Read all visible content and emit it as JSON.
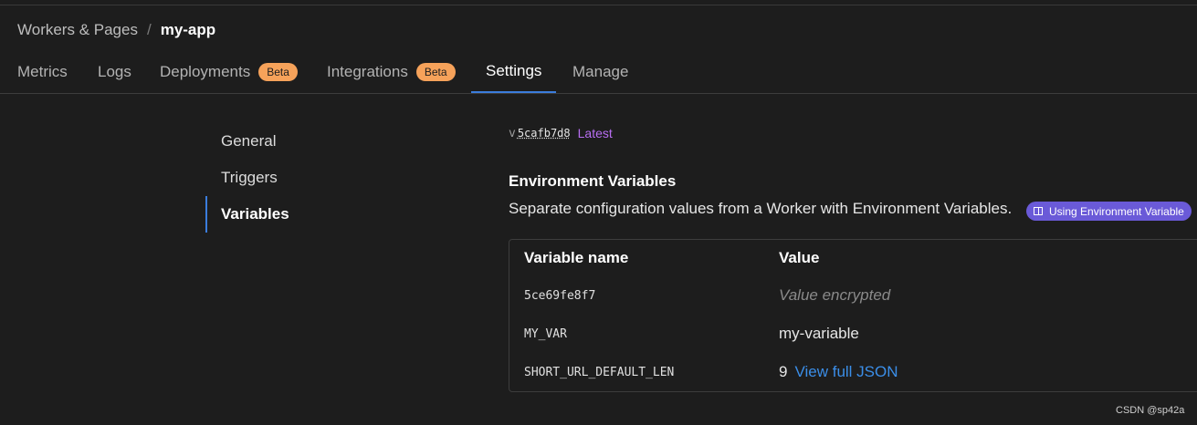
{
  "breadcrumb": {
    "parent": "Workers & Pages",
    "separator": "/",
    "current": "my-app"
  },
  "tabs": [
    {
      "label": "Metrics"
    },
    {
      "label": "Logs"
    },
    {
      "label": "Deployments",
      "badge": "Beta"
    },
    {
      "label": "Integrations",
      "badge": "Beta"
    },
    {
      "label": "Settings",
      "active": true
    },
    {
      "label": "Manage"
    }
  ],
  "sidenav": [
    {
      "label": "General"
    },
    {
      "label": "Triggers"
    },
    {
      "label": "Variables",
      "active": true
    }
  ],
  "version": {
    "prefix": "v",
    "hash": "5cafb7d8",
    "tag": "Latest"
  },
  "env": {
    "title": "Environment Variables",
    "description": "Separate configuration values from a Worker with Environment Variables.",
    "docs_link": "Using Environment Variable"
  },
  "table": {
    "headers": {
      "name": "Variable name",
      "value": "Value"
    },
    "rows": [
      {
        "name": "5ce69fe8f7",
        "value": "Value encrypted",
        "encrypted": true
      },
      {
        "name": "MY_VAR",
        "value": "my-variable"
      },
      {
        "name": "SHORT_URL_DEFAULT_LEN",
        "value": "9",
        "link": "View full JSON"
      }
    ]
  },
  "watermark": "CSDN @sp42a",
  "colors": {
    "background": "#1d1d1d",
    "accent": "#3b7ddd",
    "beta_badge": "#f6a25a",
    "latest": "#b86ef2",
    "docs_pill": "#6a5ad8",
    "link": "#3b8ee8"
  },
  "icons": {
    "docs_pill": "book-icon"
  }
}
